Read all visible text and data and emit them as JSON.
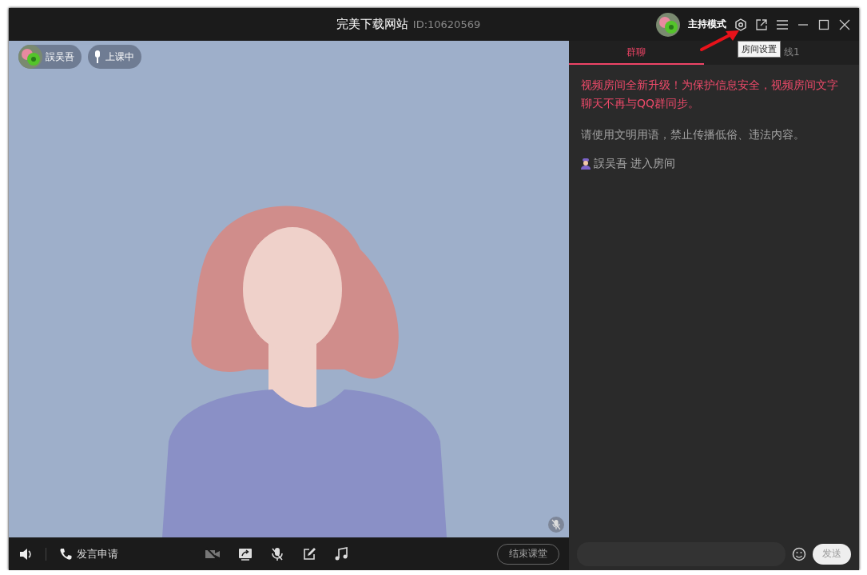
{
  "window": {
    "title": "完美下载网站",
    "room_id": "ID:10620569",
    "mode": "主持模式",
    "tooltip": "房间设置"
  },
  "video": {
    "user_badge": "誤吴吾",
    "status_badge": "上课中"
  },
  "controls": {
    "apply_speak": "发言申请",
    "end_class": "结束课堂"
  },
  "chat": {
    "tabs": [
      {
        "label": "群聊",
        "selected": true
      },
      {
        "label": "线1",
        "selected": false
      }
    ],
    "messages": [
      {
        "kind": "notice",
        "text": "视频房间全新升级！为保护信息安全，视频房间文字聊天不再与QQ群同步。"
      },
      {
        "kind": "rule",
        "text": "请使用文明用语，禁止传播低俗、违法内容。"
      },
      {
        "kind": "join",
        "user": "誤吴吾",
        "text": "进入房间"
      }
    ],
    "send_button": "发送"
  }
}
